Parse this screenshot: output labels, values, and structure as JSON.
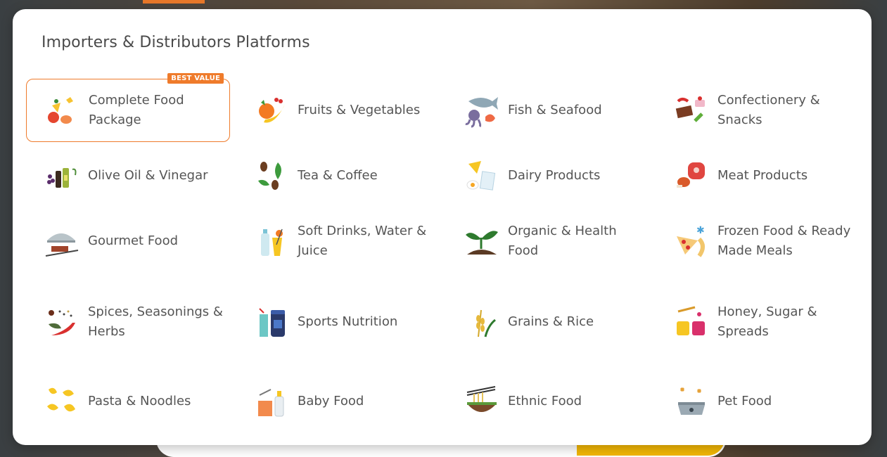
{
  "panel": {
    "title": "Importers & Distributors Platforms",
    "best_value_badge": "BEST VALUE"
  },
  "categories": [
    {
      "label": "Complete Food Package",
      "icon": "food-package-icon"
    },
    {
      "label": "Fruits & Vegetables",
      "icon": "fruits-vegetables-icon"
    },
    {
      "label": "Fish & Seafood",
      "icon": "fish-seafood-icon"
    },
    {
      "label": "Confectionery & Snacks",
      "icon": "confectionery-icon"
    },
    {
      "label": "Olive Oil & Vinegar",
      "icon": "olive-oil-icon"
    },
    {
      "label": "Tea & Coffee",
      "icon": "tea-coffee-icon"
    },
    {
      "label": "Dairy Products",
      "icon": "dairy-icon"
    },
    {
      "label": "Meat Products",
      "icon": "meat-icon"
    },
    {
      "label": "Gourmet Food",
      "icon": "gourmet-cloche-icon"
    },
    {
      "label": "Soft Drinks, Water & Juice",
      "icon": "soft-drinks-icon"
    },
    {
      "label": "Organic & Health Food",
      "icon": "organic-sprout-icon"
    },
    {
      "label": "Frozen Food & Ready Made Meals",
      "icon": "frozen-pizza-icon"
    },
    {
      "label": "Spices, Seasonings & Herbs",
      "icon": "spices-icon"
    },
    {
      "label": "Sports Nutrition",
      "icon": "sports-nutrition-icon"
    },
    {
      "label": "Grains & Rice",
      "icon": "grains-icon"
    },
    {
      "label": "Honey, Sugar & Spreads",
      "icon": "honey-icon"
    },
    {
      "label": "Pasta & Noodles",
      "icon": "pasta-icon"
    },
    {
      "label": "Baby Food",
      "icon": "baby-food-icon"
    },
    {
      "label": "Ethnic Food",
      "icon": "ethnic-bowl-icon"
    },
    {
      "label": "Pet Food",
      "icon": "pet-bowl-icon"
    }
  ],
  "colors": {
    "accent": "#ef7b2b",
    "text": "#555555",
    "title": "#4a4a4a"
  }
}
